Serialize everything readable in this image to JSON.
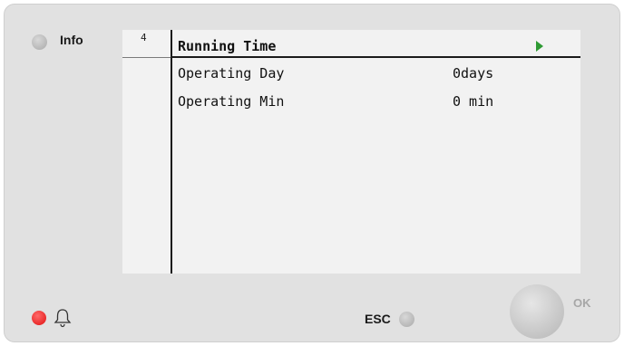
{
  "header": {
    "info_label": "Info"
  },
  "screen": {
    "page_index": "4",
    "menu_title": "Running Time",
    "rows": [
      {
        "label": "Operating Day",
        "value": "0days"
      },
      {
        "label": "Operating Min",
        "value": "0 min"
      }
    ]
  },
  "footer": {
    "esc_label": "ESC",
    "ok_label": "OK"
  },
  "icons": {
    "info": "led-icon",
    "alarm": "alarm-led-icon",
    "bell": "bell-icon",
    "play": "play-arrow-icon"
  },
  "colors": {
    "panel": "#e1e1e1",
    "screen": "#f2f2f2",
    "alarm": "#e01010",
    "play": "#2e9a33"
  }
}
